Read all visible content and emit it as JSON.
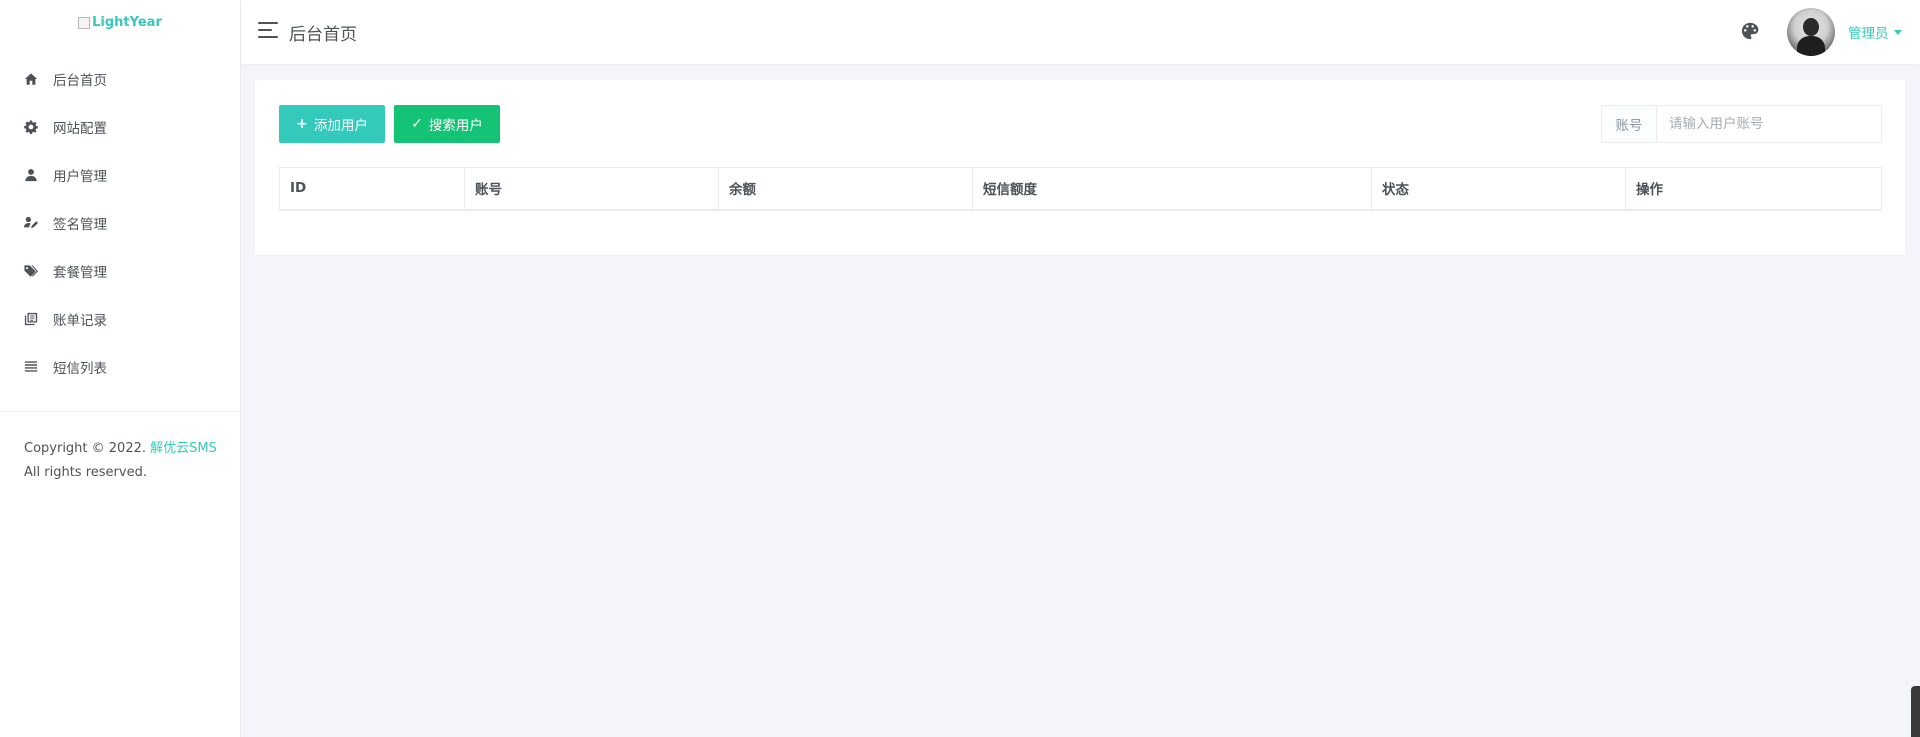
{
  "logo": {
    "alt": "LightYear"
  },
  "sidebar": {
    "items": [
      {
        "label": "后台首页",
        "icon": "home-icon"
      },
      {
        "label": "网站配置",
        "icon": "gear-icon"
      },
      {
        "label": "用户管理",
        "icon": "user-icon"
      },
      {
        "label": "签名管理",
        "icon": "signature-icon"
      },
      {
        "label": "套餐管理",
        "icon": "tags-icon"
      },
      {
        "label": "账单记录",
        "icon": "bill-icon"
      },
      {
        "label": "短信列表",
        "icon": "list-icon"
      }
    ],
    "copyright_prefix": "Copyright © 2022.",
    "copyright_link": "解优云SMS",
    "copyright_suffix": "All rights reserved."
  },
  "header": {
    "title": "后台首页",
    "user_label": "管理员"
  },
  "toolbar": {
    "add_label": "添加用户",
    "search_label": "搜索用户",
    "search_addon": "账号",
    "search_placeholder": "请输入用户账号"
  },
  "table": {
    "columns": [
      "ID",
      "账号",
      "余额",
      "短信额度",
      "状态",
      "操作"
    ],
    "rows": []
  },
  "colors": {
    "accent": "#33cabb",
    "success": "#15c377",
    "text": "#4d5259",
    "background": "#f4f5fa"
  }
}
